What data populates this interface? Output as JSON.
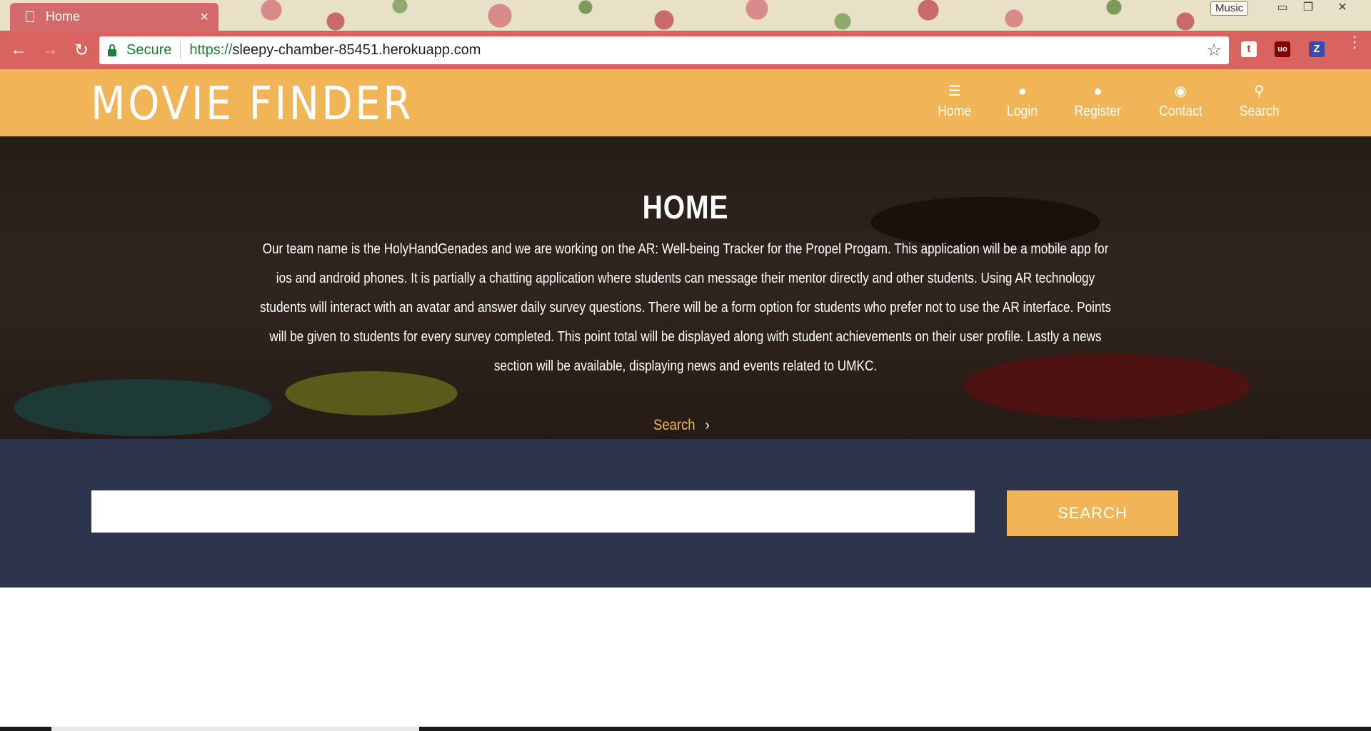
{
  "browser": {
    "tab_title": "Home",
    "tab_close": "×",
    "music_badge": "Music",
    "secure_label": "Secure",
    "url_scheme": "https://",
    "url_host": "sleepy-chamber-85451.herokuapp.com",
    "extensions": [
      {
        "name": "t-extension",
        "glyph": "t",
        "color": "#ffffff"
      },
      {
        "name": "ublock-extension",
        "glyph": "uo",
        "color": "#800000"
      },
      {
        "name": "z-extension",
        "glyph": "Z",
        "color": "#3b4ba8"
      }
    ]
  },
  "site": {
    "logo": "MOVIE FINDER",
    "nav": [
      {
        "label": "Home",
        "icon": "list-icon"
      },
      {
        "label": "Login",
        "icon": "user-icon"
      },
      {
        "label": "Register",
        "icon": "user-icon"
      },
      {
        "label": "Contact",
        "icon": "globe-icon"
      },
      {
        "label": "Search",
        "icon": "search-icon"
      }
    ]
  },
  "hero": {
    "title": "HOME",
    "text": "Our team name is the HolyHandGenades and we are working on the AR: Well-being Tracker for the Propel Progam. This application will be a mobile app for ios and android phones. It is partially a chatting application where students can message their mentor directly and other students. Using AR technology students will interact with an avatar and answer daily survey questions. There will be a form option for students who prefer not to use the AR interface. Points will be given to students for every survey completed. This point total will be displayed along with student achievements on their user profile. Lastly a news section will be available, displaying news and events related to UMKC.",
    "link_label": "Search"
  },
  "search": {
    "input_value": "",
    "button_label": "SEARCH"
  },
  "colors": {
    "accent": "#f0b557",
    "dark": "#2e354a",
    "browser_frame": "#d9645f"
  }
}
